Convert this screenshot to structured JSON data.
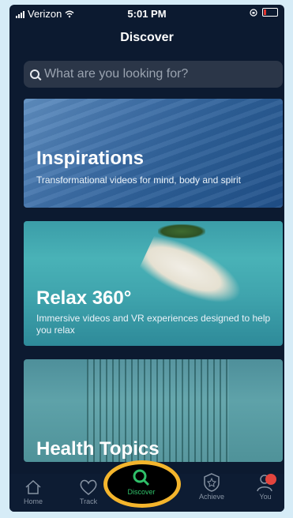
{
  "status_bar": {
    "carrier": "Verizon",
    "time": "5:01 PM"
  },
  "header": {
    "title": "Discover"
  },
  "search": {
    "placeholder": "What are you looking for?"
  },
  "cards": [
    {
      "title": "Inspirations",
      "subtitle": "Transformational videos for mind, body and spirit"
    },
    {
      "title": "Relax 360°",
      "subtitle": "Immersive videos and VR experiences designed to help you relax"
    },
    {
      "title": "Health Topics",
      "subtitle": ""
    }
  ],
  "tabs": [
    {
      "label": "Home",
      "icon": "home-icon"
    },
    {
      "label": "Track",
      "icon": "heart-icon"
    },
    {
      "label": "Discover",
      "icon": "search-icon",
      "active": true
    },
    {
      "label": "Achieve",
      "icon": "badge-icon"
    },
    {
      "label": "You",
      "icon": "person-icon"
    }
  ],
  "colors": {
    "active_tab": "#2fc069",
    "highlight_ring": "#f4b52c",
    "background": "#0c1a30"
  }
}
